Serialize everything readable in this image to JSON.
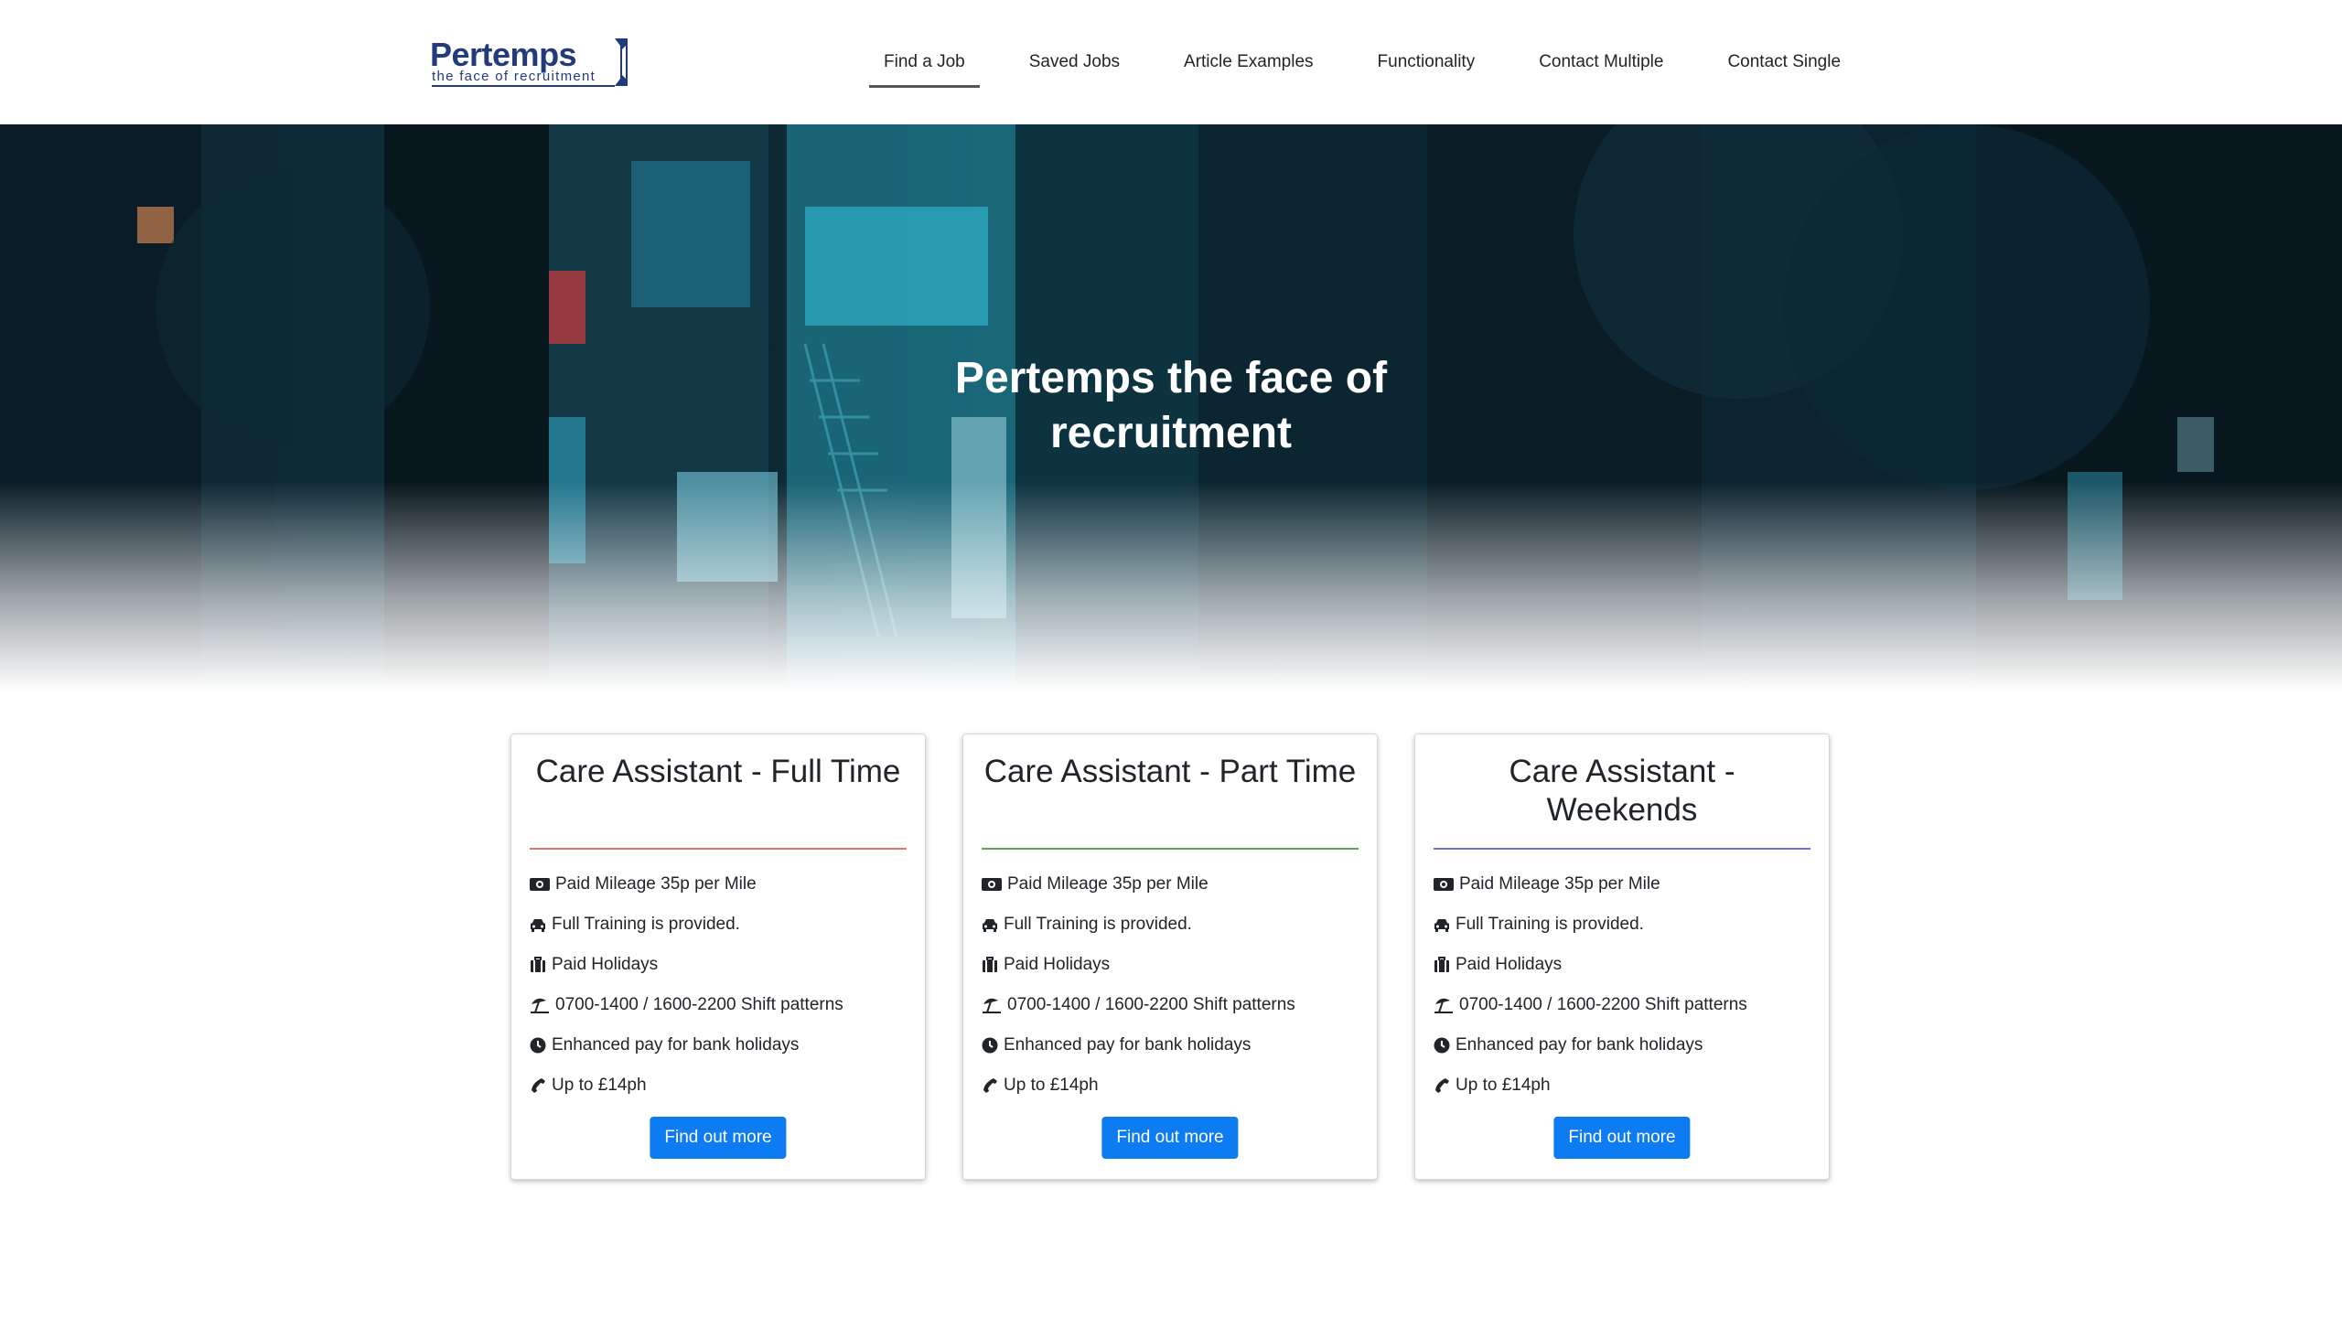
{
  "brand": {
    "name": "Pertemps",
    "tagline": "the face of recruitment",
    "color": "#233a7c"
  },
  "nav": {
    "items": [
      {
        "label": "Find a Job",
        "active": true
      },
      {
        "label": "Saved Jobs"
      },
      {
        "label": "Article Examples"
      },
      {
        "label": "Functionality"
      },
      {
        "label": "Contact Multiple"
      },
      {
        "label": "Contact Single"
      }
    ]
  },
  "hero": {
    "title": "Pertemps the face of recruitment"
  },
  "accent": "#0d7cf2",
  "cards": [
    {
      "title": "Care Assistant - Full Time",
      "divider_color": "#e2706f",
      "features": [
        {
          "icon": "money-icon",
          "text": "Paid Mileage 35p per Mile"
        },
        {
          "icon": "car-icon",
          "text": "Full Training is provided."
        },
        {
          "icon": "suitcase-icon",
          "text": "Paid Holidays"
        },
        {
          "icon": "beach-umbrella-icon",
          "text": "0700-1400 / 1600-2200 Shift patterns"
        },
        {
          "icon": "clock-icon",
          "text": "Enhanced pay for bank holidays"
        },
        {
          "icon": "phone-icon",
          "text": "Up to £14ph"
        }
      ],
      "button": "Find out more"
    },
    {
      "title": "Care Assistant - Part Time",
      "divider_color": "#5aa75a",
      "features": [
        {
          "icon": "money-icon",
          "text": "Paid Mileage 35p per Mile"
        },
        {
          "icon": "car-icon",
          "text": "Full Training is provided."
        },
        {
          "icon": "suitcase-icon",
          "text": "Paid Holidays"
        },
        {
          "icon": "beach-umbrella-icon",
          "text": "0700-1400 / 1600-2200 Shift patterns"
        },
        {
          "icon": "clock-icon",
          "text": "Enhanced pay for bank holidays"
        },
        {
          "icon": "phone-icon",
          "text": "Up to £14ph"
        }
      ],
      "button": "Find out more"
    },
    {
      "title": "Care Assistant - Weekends",
      "divider_color": "#6a72d8",
      "features": [
        {
          "icon": "money-icon",
          "text": "Paid Mileage 35p per Mile"
        },
        {
          "icon": "car-icon",
          "text": "Full Training is provided."
        },
        {
          "icon": "suitcase-icon",
          "text": "Paid Holidays"
        },
        {
          "icon": "beach-umbrella-icon",
          "text": "0700-1400 / 1600-2200 Shift patterns"
        },
        {
          "icon": "clock-icon",
          "text": "Enhanced pay for bank holidays"
        },
        {
          "icon": "phone-icon",
          "text": "Up to £14ph"
        }
      ],
      "button": "Find out more"
    }
  ]
}
